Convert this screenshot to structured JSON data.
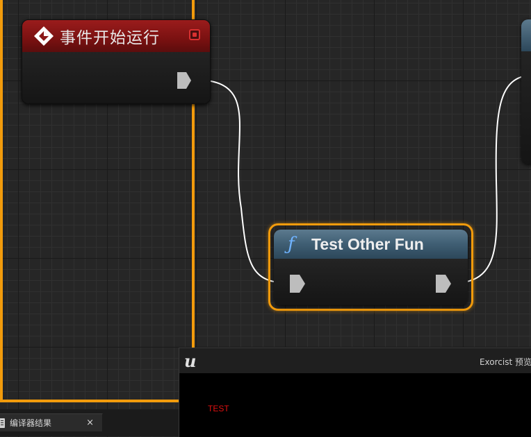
{
  "event_node": {
    "title": "事件开始运行",
    "header_color": "#8b1717",
    "icon": "event-diamond-icon",
    "delegate_pin_color": "#d83030"
  },
  "function_node": {
    "icon_glyph": "ƒ",
    "title": "Test Other Fun",
    "header_color": "#3f5e73",
    "selected_outline_color": "#f29b0c"
  },
  "wire_color": "#ffffff",
  "preview_window": {
    "logo": "u",
    "title": "Exorcist 预览",
    "output_text": "TEST",
    "output_color": "#e01010"
  },
  "results_tab": {
    "icon": "document-icon",
    "label": "编译器结果",
    "close": "×"
  }
}
